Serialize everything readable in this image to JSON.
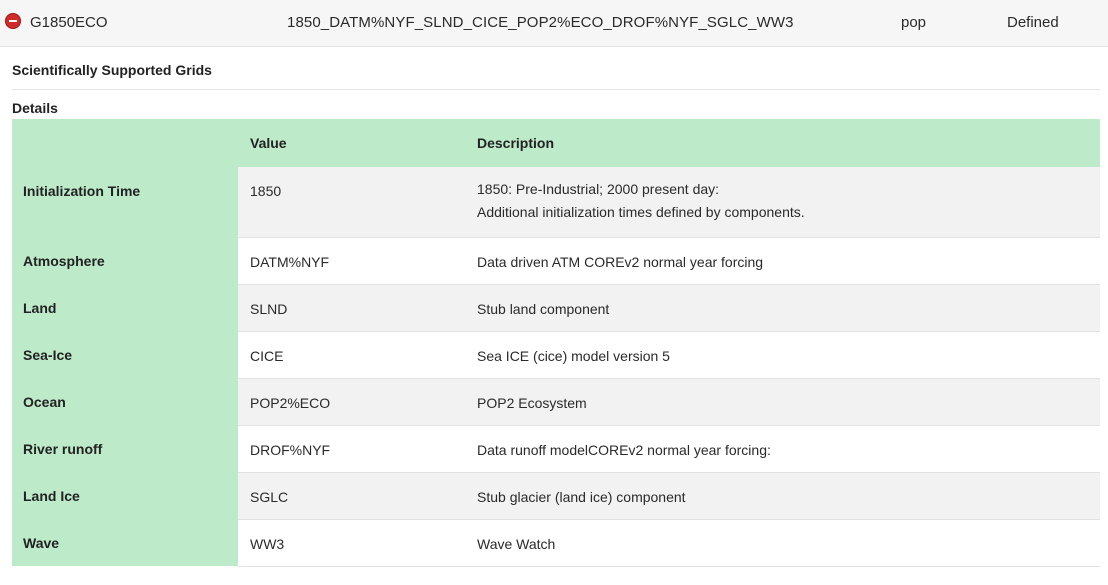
{
  "compset_row": {
    "name": "G1850ECO",
    "longname": "1850_DATM%NYF_SLND_CICE_POP2%ECO_DROF%NYF_SGLC_WW3",
    "primary_component": "pop",
    "status": "Defined",
    "collapse_icon": "minus-circle-icon",
    "collapse_color": "#cf2b2b"
  },
  "sections": {
    "grids_title": "Scientifically Supported Grids",
    "details_title": "Details"
  },
  "details_table": {
    "headers": [
      "",
      "Value",
      "Description"
    ],
    "header_color": "#bdeac9",
    "rows": [
      {
        "label": "Initialization Time",
        "value": "1850",
        "description": [
          "1850: Pre-Industrial; 2000 present day:",
          "Additional initialization times defined by components."
        ]
      },
      {
        "label": "Atmosphere",
        "value": "DATM%NYF",
        "description": [
          "Data driven ATM COREv2 normal year forcing"
        ]
      },
      {
        "label": "Land",
        "value": "SLND",
        "description": [
          "Stub land component"
        ]
      },
      {
        "label": "Sea-Ice",
        "value": "CICE",
        "description": [
          "Sea ICE (cice) model version 5"
        ]
      },
      {
        "label": "Ocean",
        "value": "POP2%ECO",
        "description": [
          "POP2 Ecosystem"
        ]
      },
      {
        "label": "River runoff",
        "value": "DROF%NYF",
        "description": [
          "Data runoff modelCOREv2 normal year forcing:"
        ]
      },
      {
        "label": "Land Ice",
        "value": "SGLC",
        "description": [
          "Stub glacier (land ice) component"
        ]
      },
      {
        "label": "Wave",
        "value": "WW3",
        "description": [
          "Wave Watch"
        ]
      }
    ]
  }
}
